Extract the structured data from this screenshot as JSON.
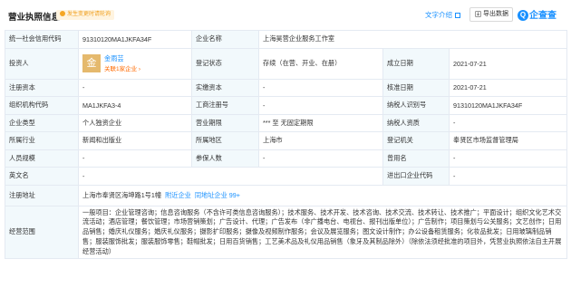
{
  "header": {
    "title": "营业执照信息",
    "badge": "发生变更时请轮询",
    "text_intro": "文字介绍",
    "export_label": "导出数据",
    "logo_text": "企查查"
  },
  "table": {
    "credit_code_label": "统一社会信用代码",
    "credit_code": "91310120MA1JKFA34F",
    "company_name_label": "企业名称",
    "company_name": "上海昊营企业服务工作室",
    "investor_label": "投资人",
    "investor_avatar": "金",
    "investor_name": "金雨芸",
    "investor_sub": "关联1家企业 ›",
    "reg_status_label": "登记状态",
    "reg_status": "存续（在营、开业、在册）",
    "est_date_label": "成立日期",
    "est_date": "2021-07-21",
    "reg_capital_label": "注册资本",
    "reg_capital": "-",
    "paid_capital_label": "实缴资本",
    "paid_capital": "-",
    "approve_date_label": "核准日期",
    "approve_date": "2021-07-21",
    "org_code_label": "组织机构代码",
    "org_code": "MA1JKFA3-4",
    "biz_reg_no_label": "工商注册号",
    "biz_reg_no": "-",
    "taxpayer_id_label": "纳税人识别号",
    "taxpayer_id": "91310120MA1JKFA34F",
    "type_label": "企业类型",
    "type": "个人独资企业",
    "term_label": "营业期限",
    "term": "*** 至 无固定期限",
    "taxpayer_qual_label": "纳税人资质",
    "taxpayer_qual": "-",
    "industry_label": "所属行业",
    "industry": "新闻和出版业",
    "region_label": "所属地区",
    "region": "上海市",
    "authority_label": "登记机关",
    "authority": "奉贤区市场监督管理局",
    "staff_label": "人员规模",
    "staff": "-",
    "insured_label": "参保人数",
    "insured": "-",
    "former_name_label": "曾用名",
    "former_name": "-",
    "english_label": "英文名",
    "english": "-",
    "import_export_label": "进出口企业代码",
    "import_export": "-",
    "address_label": "注册地址",
    "address": "上海市奉贤区海坤路1号1幢",
    "nearby": "附近企业",
    "same_address": "同地址企业 99+",
    "scope_label": "经营范围",
    "scope": "一般项目：企业管理咨询；信息咨询服务（不含许可类信息咨询服务）；技术服务、技术开发、技术咨询、技术交流、技术转让、技术推广；平面设计；组织文化艺术交流活动；酒店管理；餐饮管理；市场营销策划；广告设计、代理；广告发布（非广播电台、电视台、报刊出版单位）；广告制作；项目策划与公关服务；文艺创作；日用品销售；婚庆礼仪服务；婚庆礼仪服务；摄影扩印服务；摄像及视频制作服务；会议及展览服务；图文设计制作；办公设备租赁服务；化妆品批发；日用玻璃制品销售；服装服饰批发；服装服饰零售；鞋帽批发；日用百货销售；工艺美术品及礼仪用品销售（象牙及其制品除外）（除依法须经批准的项目外，凭营业执照依法自主开展经营活动）"
  },
  "colors": {
    "accent": "#1890ff",
    "label_bg": "#f2f9fc",
    "border": "#e4eaf2",
    "warn": "#ff6a00"
  }
}
